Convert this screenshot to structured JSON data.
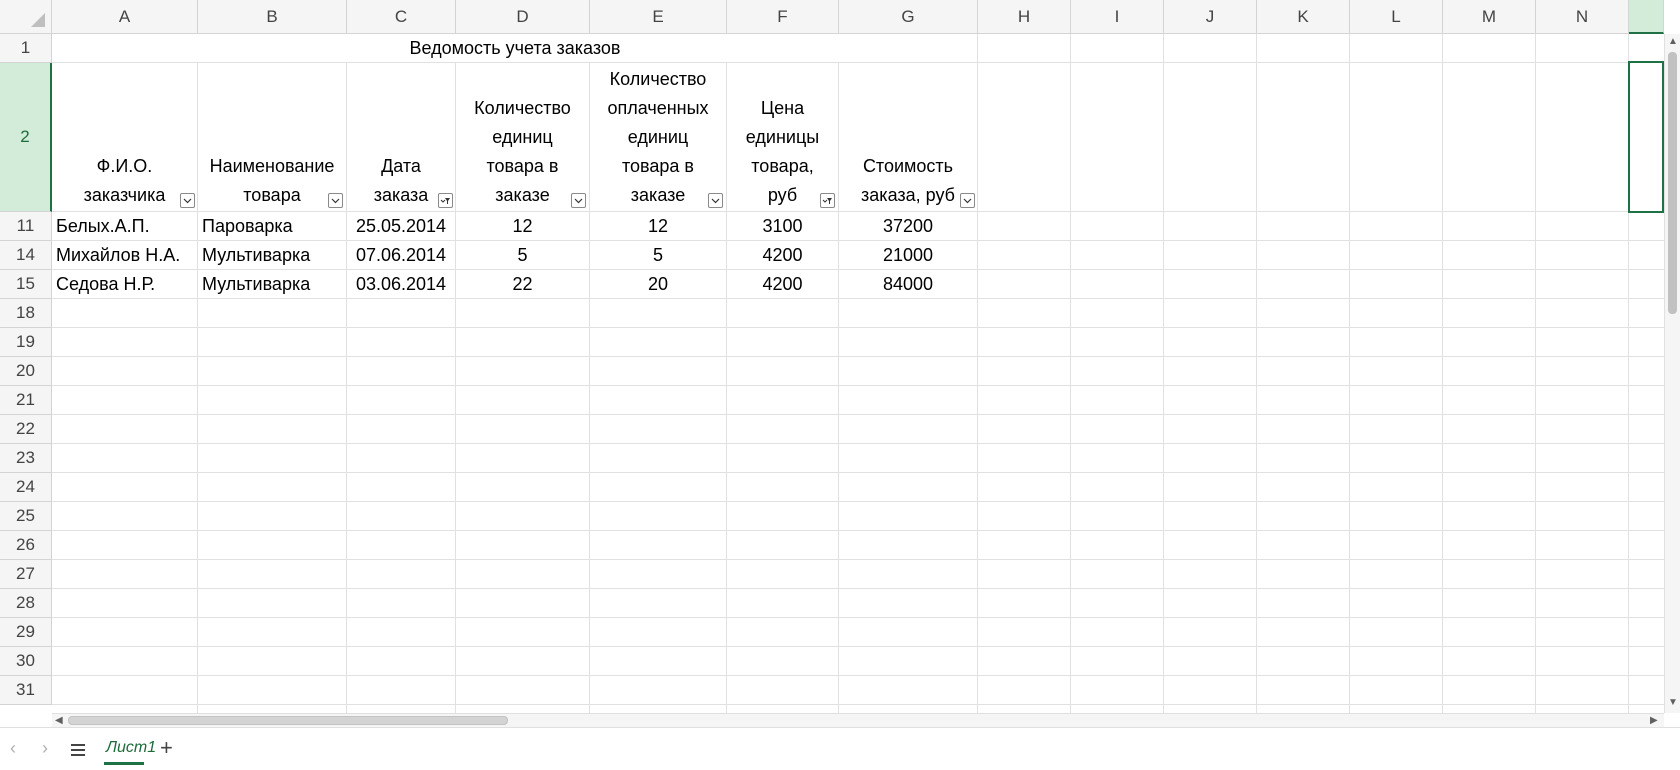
{
  "columns": [
    "A",
    "B",
    "C",
    "D",
    "E",
    "F",
    "G",
    "H",
    "I",
    "J",
    "K",
    "L",
    "M",
    "N"
  ],
  "rows": [
    "1",
    "2",
    "11",
    "14",
    "15",
    "18",
    "19",
    "20",
    "21",
    "22",
    "23",
    "24",
    "25",
    "26",
    "27",
    "28",
    "29",
    "30",
    "31"
  ],
  "title": "Ведомость учета заказов",
  "headers": {
    "a": [
      "Ф.И.О.",
      "заказчика"
    ],
    "b": [
      "Наименование",
      "товара"
    ],
    "c": [
      "Дата",
      "заказа"
    ],
    "d": [
      "Количество",
      "единиц",
      "товара в",
      "заказе"
    ],
    "e": [
      "Количество",
      "оплаченных",
      "единиц",
      "товара в",
      "заказе"
    ],
    "f": [
      "Цена",
      "единицы",
      "товара,",
      "руб"
    ],
    "g": [
      "Стоимость",
      "заказа, руб"
    ]
  },
  "data_rows": [
    {
      "name": "Белых.А.П.",
      "product": "Пароварка",
      "date": "25.05.2014",
      "qty": "12",
      "paid": "12",
      "price": "3100",
      "cost": "37200"
    },
    {
      "name": "Михайлов Н.А.",
      "product": "Мультиварка",
      "date": "07.06.2014",
      "qty": "5",
      "paid": "5",
      "price": "4200",
      "cost": "21000"
    },
    {
      "name": "Седова Н.Р.",
      "product": "Мультиварка",
      "date": "03.06.2014",
      "qty": "22",
      "paid": "20",
      "price": "4200",
      "cost": "84000"
    }
  ],
  "sheet_tab": "Лист1",
  "colors": {
    "accent": "#1e7145",
    "header_bg": "#f5f5f5",
    "selected_header_bg": "#d3ecd9",
    "grid": "#e1e1e1"
  },
  "icons": {
    "filter": "filter-dropdown-icon",
    "filter_active": "filter-applied-icon",
    "menu": "sheets-menu-icon",
    "add": "add-sheet-icon"
  }
}
